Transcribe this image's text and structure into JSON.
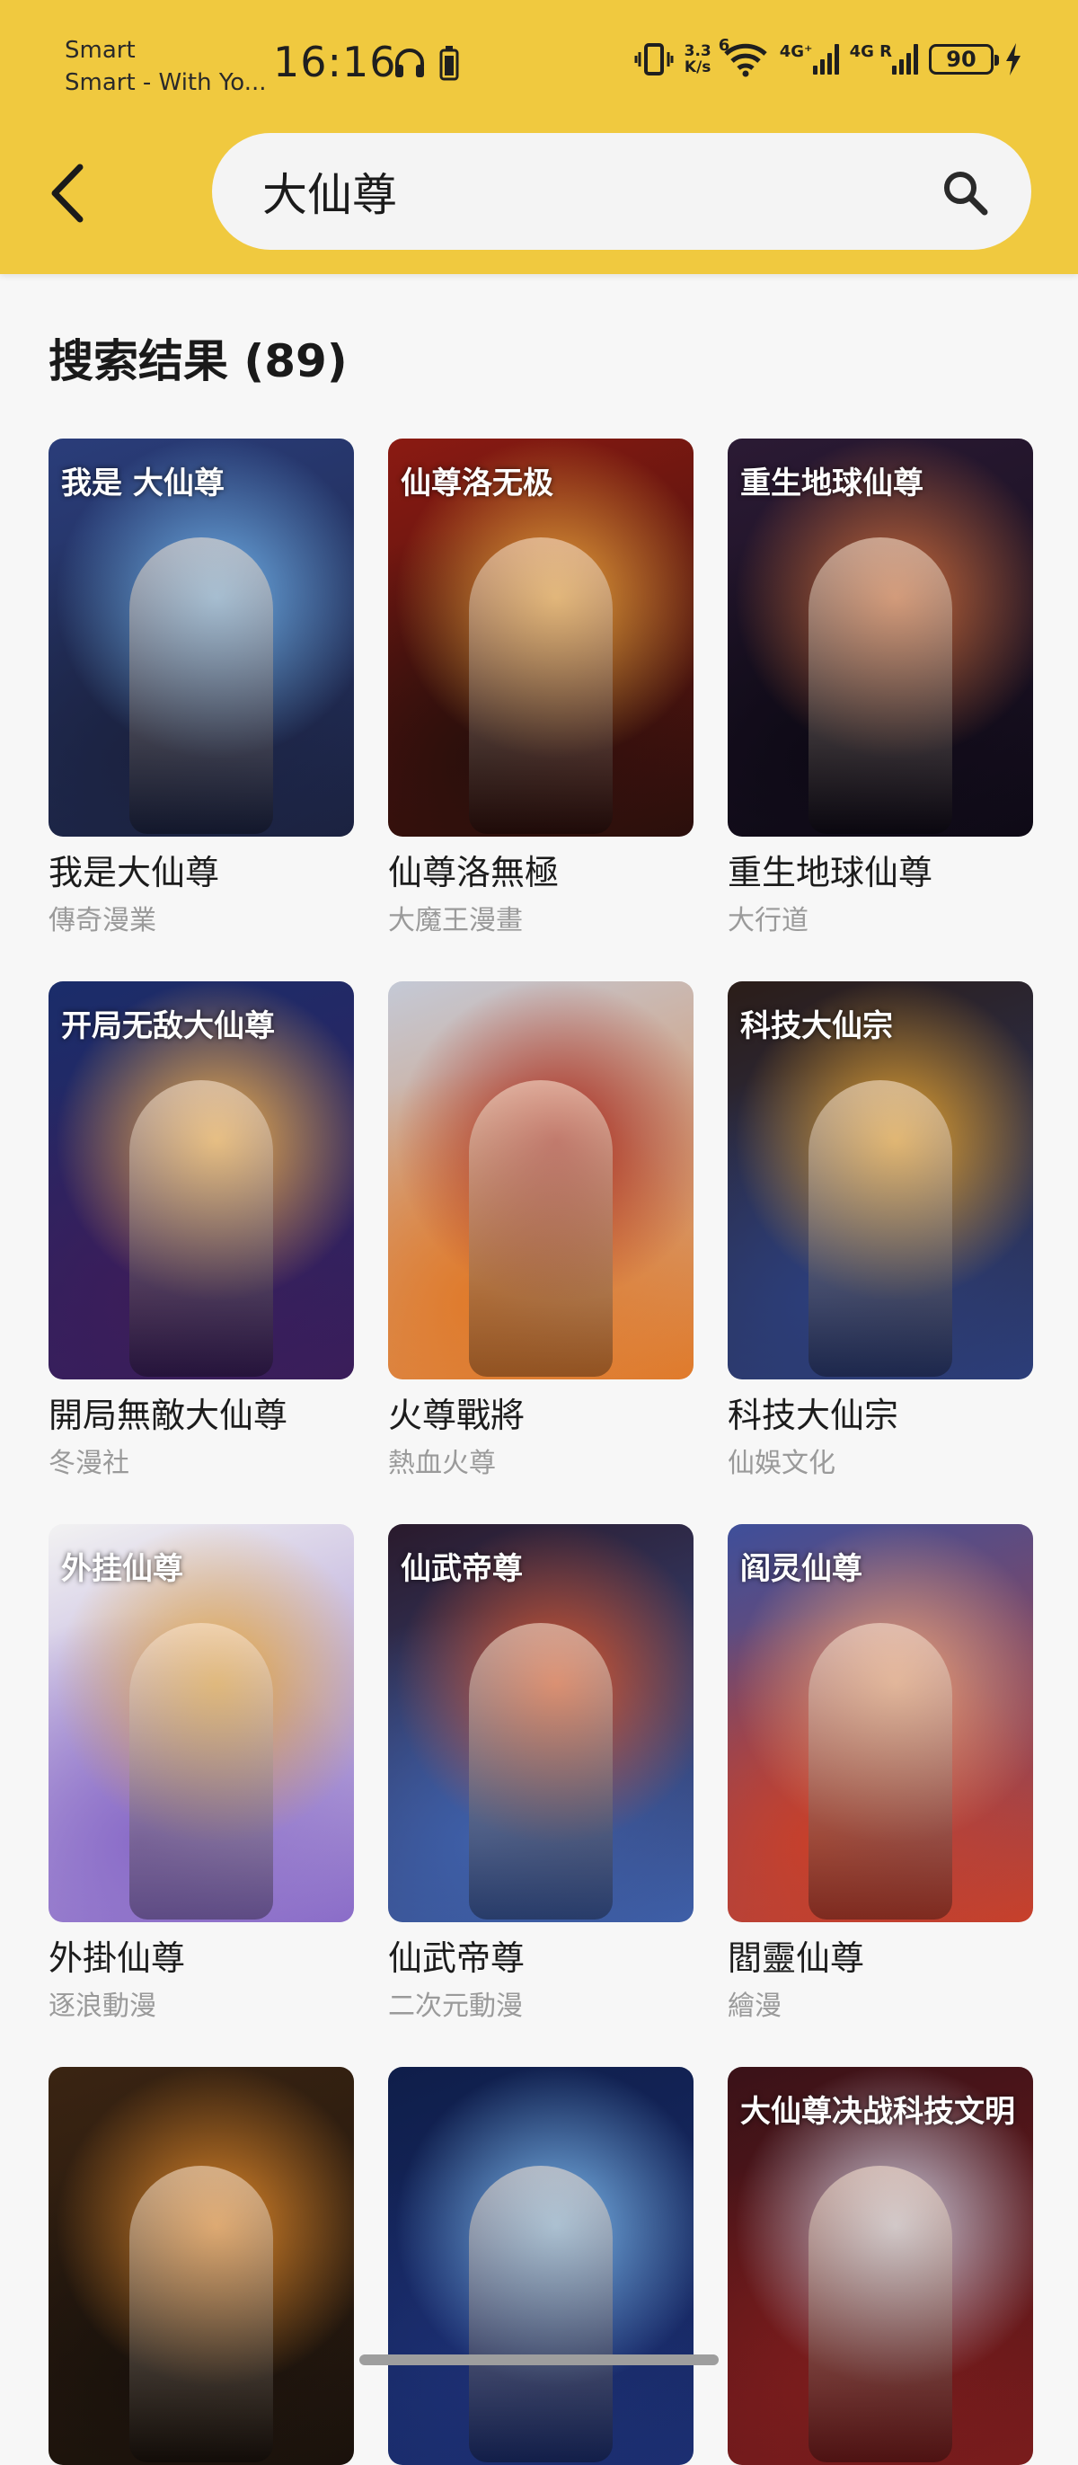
{
  "status_bar": {
    "carrier_line1": "Smart",
    "carrier_line2": "Smart - With Yo...",
    "time": "16:16",
    "net_speed_value": "3.3",
    "net_speed_unit": "K/s",
    "wifi_label": "6",
    "signal1_label": "4G⁺",
    "signal2_label": "4G R",
    "battery": "90"
  },
  "header": {
    "search_value": "大仙尊"
  },
  "results": {
    "title": "搜索结果 (89)"
  },
  "comics": [
    {
      "title": "我是大仙尊",
      "author": "傳奇漫業",
      "cover_text": "我是 大仙尊",
      "colors": [
        "#2a3d7a",
        "#6fb0e8",
        "#1b2240"
      ]
    },
    {
      "title": "仙尊洛無極",
      "author": "大魔王漫畫",
      "cover_text": "仙尊洛无极",
      "colors": [
        "#8b1a12",
        "#e8a23a",
        "#2a0f0c"
      ]
    },
    {
      "title": "重生地球仙尊",
      "author": "大行道",
      "cover_text": "重生地球仙尊",
      "colors": [
        "#2b1a34",
        "#c96a3a",
        "#0e0a16"
      ]
    },
    {
      "title": "開局無敵大仙尊",
      "author": "冬漫社",
      "cover_text": "开局无敌大仙尊",
      "colors": [
        "#1a2d6a",
        "#f2b24c",
        "#3b1d5a"
      ]
    },
    {
      "title": "火尊戰將",
      "author": "熱血火尊",
      "cover_text": "",
      "colors": [
        "#c4c9d6",
        "#a6281e",
        "#e07a2a"
      ]
    },
    {
      "title": "科技大仙宗",
      "author": "仙娛文化",
      "cover_text": "科技大仙宗",
      "colors": [
        "#2b1d18",
        "#e6a22c",
        "#2c3e7a"
      ]
    },
    {
      "title": "外掛仙尊",
      "author": "逐浪動漫",
      "cover_text": "外挂仙尊",
      "colors": [
        "#f2f2f2",
        "#e3a640",
        "#8a6cc8"
      ]
    },
    {
      "title": "仙武帝尊",
      "author": "二次元動漫",
      "cover_text": "仙武帝尊",
      "colors": [
        "#2a1a2c",
        "#d9552a",
        "#3e5fa8"
      ]
    },
    {
      "title": "閻靈仙尊",
      "author": "繪漫",
      "cover_text": "阎灵仙尊",
      "colors": [
        "#3e4f9a",
        "#e8a17a",
        "#c8402a"
      ]
    },
    {
      "title": "",
      "author": "",
      "cover_text": "",
      "colors": [
        "#3a2412",
        "#e0882a",
        "#1a120c"
      ]
    },
    {
      "title": "",
      "author": "",
      "cover_text": "",
      "colors": [
        "#0f1e4a",
        "#7ab6ea",
        "#1c2f72"
      ]
    },
    {
      "title": "",
      "author": "",
      "cover_text": "大仙尊决战科技文明",
      "colors": [
        "#3a1218",
        "#c8c6d8",
        "#7a1c1c"
      ]
    }
  ]
}
